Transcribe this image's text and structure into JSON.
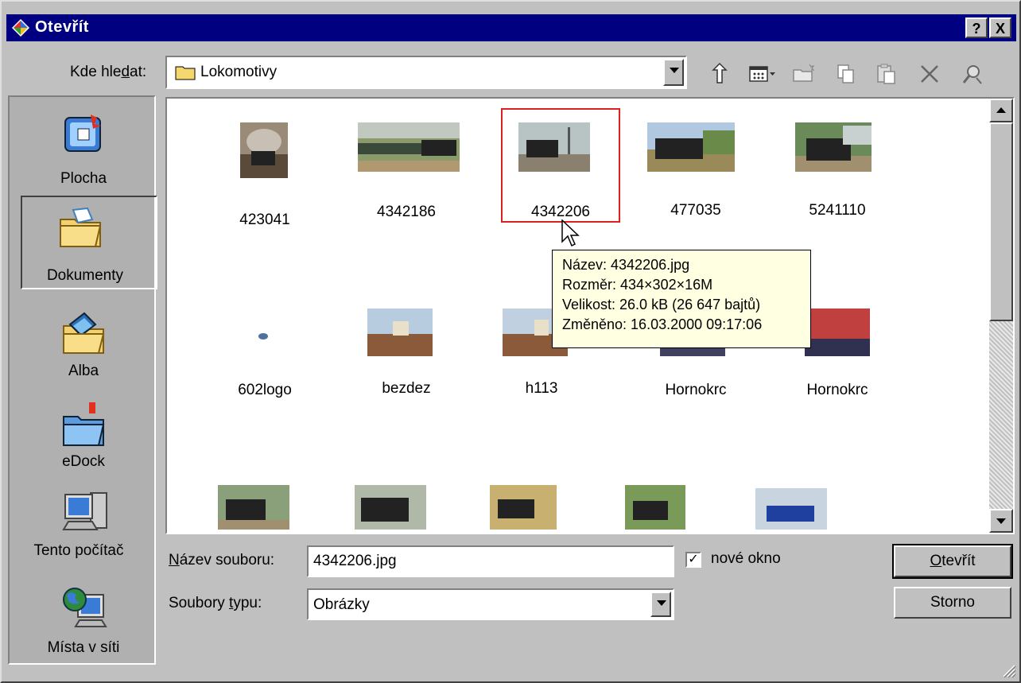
{
  "window": {
    "title": "Otevřít",
    "help_label": "?",
    "close_label": "X"
  },
  "look_in": {
    "label_pre": "Kde hle",
    "label_accel": "d",
    "label_post": "at:",
    "value": "Lokomotivy"
  },
  "toolbar": {
    "icons": [
      "up-folder-icon",
      "views-menu-icon",
      "new-folder-icon",
      "copy-icon",
      "paste-icon",
      "delete-icon",
      "search-web-icon"
    ]
  },
  "places": [
    {
      "label": "Plocha",
      "icon": "desktop-icon"
    },
    {
      "label": "Dokumenty",
      "icon": "documents-folder-icon"
    },
    {
      "label": "Alba",
      "icon": "albums-folder-icon"
    },
    {
      "label": "eDock",
      "icon": "edock-folder-icon"
    },
    {
      "label": "Tento počítač",
      "icon": "my-computer-icon"
    },
    {
      "label": "Místa v síti",
      "icon": "network-places-icon"
    }
  ],
  "files": [
    {
      "name": "423041"
    },
    {
      "name": "4342186"
    },
    {
      "name": "4342206"
    },
    {
      "name": "477035"
    },
    {
      "name": "5241110"
    },
    {
      "name": "602logo"
    },
    {
      "name": "bezdez"
    },
    {
      "name": "h113"
    },
    {
      "name": "Hornokrc"
    },
    {
      "name": "Hornokrc"
    },
    {
      "name": ""
    },
    {
      "name": ""
    },
    {
      "name": ""
    },
    {
      "name": ""
    },
    {
      "name": ""
    }
  ],
  "tooltip": {
    "line1": "Název: 4342206.jpg",
    "line2": "Rozměr: 434×302×16M",
    "line3": "Velikost: 26.0 kB (26 647 bajtů)",
    "line4": "Změněno: 16.03.2000 09:17:06"
  },
  "filename": {
    "label_accel": "N",
    "label_post": "ázev souboru:",
    "value": "4342206.jpg"
  },
  "filetype": {
    "label_pre": "Soubory ",
    "label_accel": "t",
    "label_post": "ypu:",
    "value": "Obrázky"
  },
  "new_window": {
    "label": "nové okno",
    "checked": true,
    "check_glyph": "✓"
  },
  "buttons": {
    "open_accel": "O",
    "open_post": "tevřít",
    "cancel": "Storno"
  },
  "colors": {
    "titlebar": "#000080",
    "selection_border": "#e02020",
    "tooltip_bg": "#ffffe1"
  }
}
